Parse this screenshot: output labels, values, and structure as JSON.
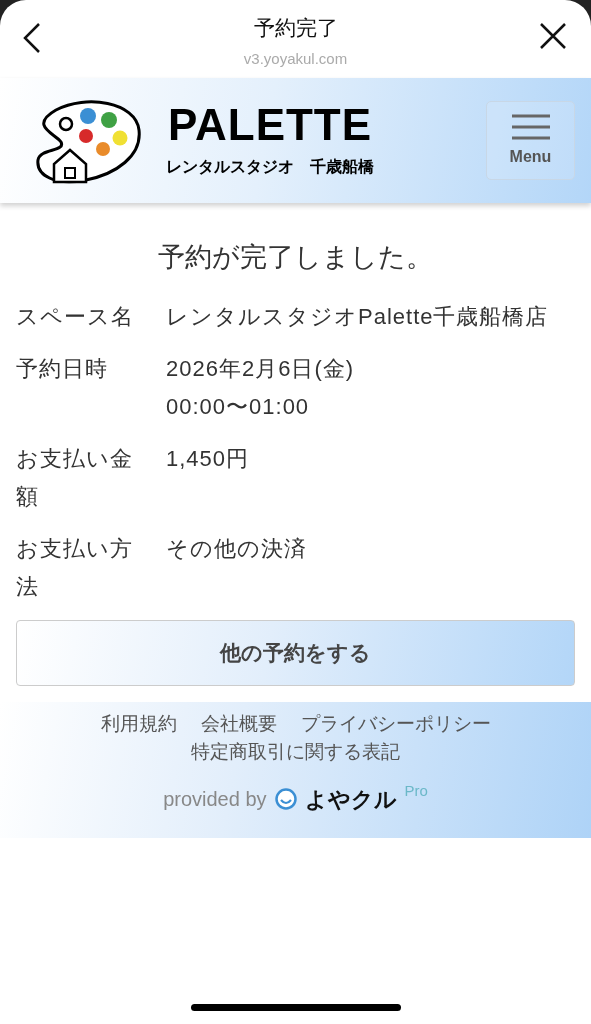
{
  "browser_bar": {
    "title": "予約完了",
    "url": "v3.yoyakul.com"
  },
  "header": {
    "brand": "PALETTE",
    "subtitle": "レンタルスタジオ　千歳船橋",
    "menu_label": "Menu"
  },
  "heading": "予約が完了しました。",
  "details": [
    {
      "label": "スペース名",
      "value": "レンタルスタジオPalette千歳船橋店"
    },
    {
      "label": "予約日時",
      "value": "2026年2月6日(金)\n00:00〜01:00"
    },
    {
      "label": "お支払い金額",
      "value": "1,450円"
    },
    {
      "label": "お支払い方法",
      "value": "その他の決済"
    }
  ],
  "action_button": "他の予約をする",
  "footer": {
    "links": [
      "利用規約",
      "会社概要",
      "プライバシーポリシー",
      "特定商取引に関する表記"
    ],
    "provided_by": "provided by",
    "provider_logo": "よやクル",
    "provider_tier": "Pro"
  }
}
